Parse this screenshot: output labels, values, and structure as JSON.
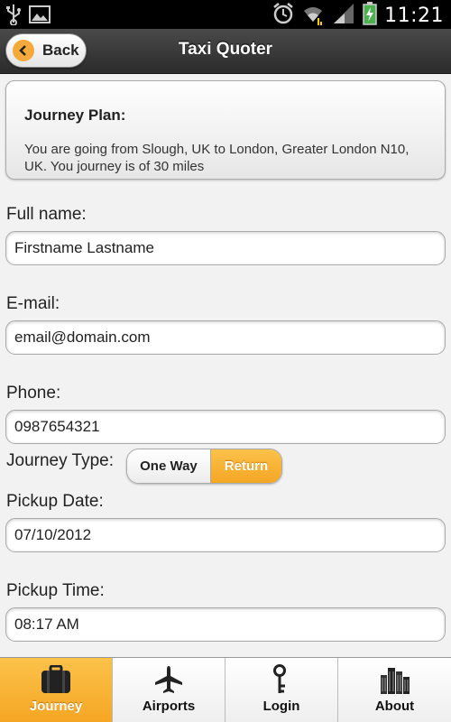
{
  "status_bar": {
    "time": "11:21",
    "icons": [
      "usb-icon",
      "image-icon",
      "alarm-icon",
      "wifi-icon",
      "signal-icon",
      "battery-charging-icon"
    ]
  },
  "header": {
    "back_label": "Back",
    "title": "Taxi Quoter"
  },
  "journey_plan": {
    "title": "Journey Plan:",
    "text": "You are going from Slough, UK to London, Greater London N10, UK. You journey is of 30 miles"
  },
  "form": {
    "full_name": {
      "label": "Full name:",
      "value": "Firstname Lastname"
    },
    "email": {
      "label": "E-mail:",
      "value": "email@domain.com"
    },
    "phone": {
      "label": "Phone:",
      "value": "0987654321"
    },
    "journey_type": {
      "label": "Journey Type:",
      "options": [
        "One Way",
        "Return"
      ],
      "selected": "Return"
    },
    "pickup_date": {
      "label": "Pickup Date:",
      "value": "07/10/2012"
    },
    "pickup_time": {
      "label": "Pickup Time:",
      "value": "08:17 AM"
    }
  },
  "tabs": [
    {
      "label": "Journey",
      "icon": "briefcase-icon",
      "active": true
    },
    {
      "label": "Airports",
      "icon": "airplane-icon",
      "active": false
    },
    {
      "label": "Login",
      "icon": "key-icon",
      "active": false
    },
    {
      "label": "About",
      "icon": "buildings-icon",
      "active": false
    }
  ],
  "colors": {
    "accent": "#f5a623",
    "header": "#333333",
    "background": "#f2f2f2"
  }
}
